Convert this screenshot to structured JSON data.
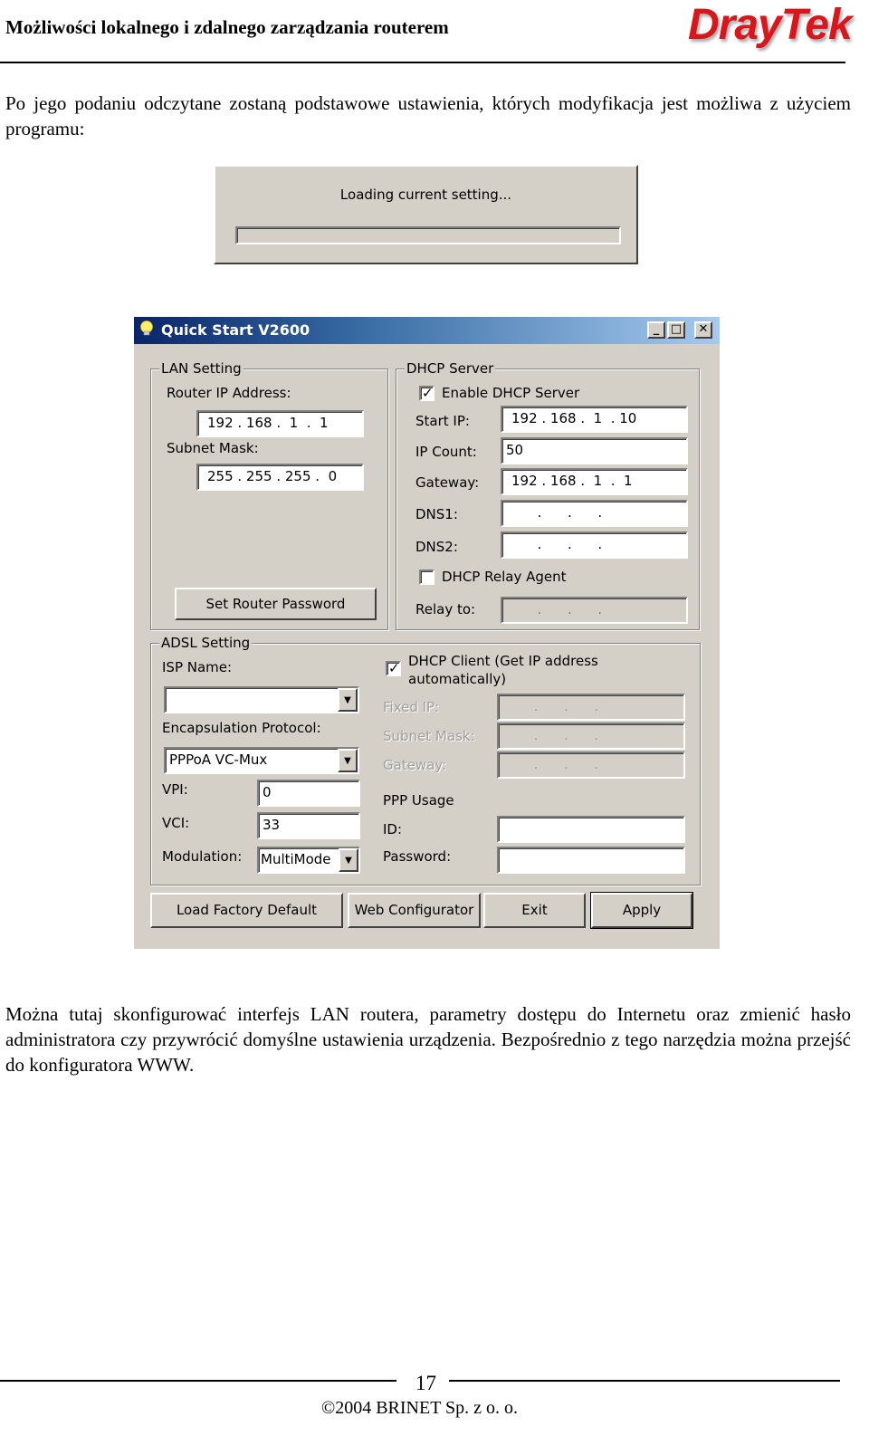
{
  "header": {
    "title": "Możliwości lokalnego i zdalnego zarządzania routerem",
    "logo": "DrayTek",
    "logo_color": "#d9161c"
  },
  "intro_paragraph": "Po jego podaniu odczytane zostaną podstawowe ustawienia, których modyfikacja jest możliwa z użyciem programu:",
  "loading_dialog": {
    "message": "Loading current setting...",
    "progress": 0
  },
  "window": {
    "title": "Quick Start V2600",
    "icon": "lightbulb-icon",
    "controls": {
      "minimize": "_",
      "maximize": "□",
      "close": "✕"
    },
    "lan": {
      "group_label": "LAN Setting",
      "router_ip_label": "Router IP Address:",
      "router_ip": "192 . 168 .  1  .  1",
      "subnet_label": "Subnet Mask:",
      "subnet": "255 . 255 . 255 .  0",
      "set_password_button": "Set Router Password"
    },
    "dhcp": {
      "group_label": "DHCP Server",
      "enable_label": "Enable DHCP Server",
      "enable_checked": true,
      "start_ip_label": "Start IP:",
      "start_ip": "192 . 168 .  1  . 10",
      "ip_count_label": "IP Count:",
      "ip_count": "50",
      "gateway_label": "Gateway:",
      "gateway": "192 . 168 .  1  .  1",
      "dns1_label": "DNS1:",
      "dns1": "      .      .      .",
      "dns2_label": "DNS2:",
      "dns2": "      .      .      .",
      "relay_agent_label": "DHCP Relay Agent",
      "relay_agent_checked": false,
      "relay_to_label": "Relay to:",
      "relay_to": "      .      .      ."
    },
    "adsl": {
      "group_label": "ADSL Setting",
      "isp_label": "ISP Name:",
      "isp_value": "",
      "encap_label": "Encapsulation Protocol:",
      "encap_value": "PPPoA VC-Mux",
      "vpi_label": "VPI:",
      "vpi": "0",
      "vci_label": "VCI:",
      "vci": "33",
      "modulation_label": "Modulation:",
      "modulation": "MultiMode",
      "dhcp_client_label_1": "DHCP Client (Get IP address",
      "dhcp_client_label_2": "automatically)",
      "dhcp_client_checked": true,
      "fixed_ip_label": "Fixed IP:",
      "fixed_ip": "      .      .      .",
      "subnet_label": "Subnet Mask:",
      "subnet": "      .      .      .",
      "gateway_label": "Gateway:",
      "gateway": "      .      .      .",
      "ppp_usage_label": "PPP Usage",
      "id_label": "ID:",
      "id_value": "",
      "password_label": "Password:",
      "password_value": ""
    },
    "buttons": {
      "load_default": "Load Factory Default",
      "web_config": "Web Configurator",
      "exit": "Exit",
      "apply": "Apply"
    }
  },
  "body_paragraph": "Można tutaj skonfigurować interfejs LAN routera, parametry dostępu do Internetu oraz zmienić hasło administratora czy przywrócić domyślne ustawienia urządzenia. Bezpośrednio z tego narzędzia można przejść do konfiguratora WWW.",
  "footer": {
    "page_number": "17",
    "copyright": "©2004 BRINET Sp. z  o. o."
  }
}
